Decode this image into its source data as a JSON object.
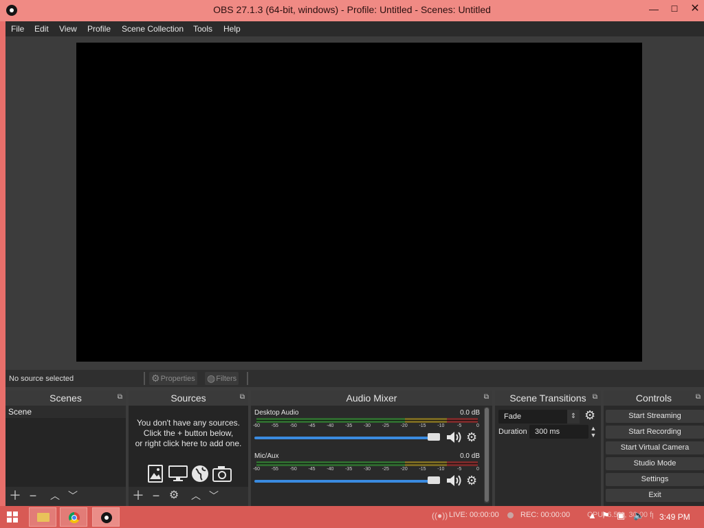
{
  "window": {
    "title": "OBS 27.1.3 (64-bit, windows) - Profile: Untitled - Scenes: Untitled",
    "controls": {
      "minimize": "—",
      "maximize": "☐",
      "close": "✕"
    }
  },
  "menu": [
    "File",
    "Edit",
    "View",
    "Profile",
    "Scene Collection",
    "Tools",
    "Help"
  ],
  "source_bar": {
    "no_source": "No source selected",
    "properties": "Properties",
    "filters": "Filters"
  },
  "scenes": {
    "title": "Scenes",
    "items": [
      "Scene"
    ]
  },
  "sources": {
    "title": "Sources",
    "empty_line1": "You don't have any sources.",
    "empty_line2": "Click the + button below,",
    "empty_line3": "or right click here to add one."
  },
  "audio_mixer": {
    "title": "Audio Mixer",
    "scale": [
      "-60",
      "-55",
      "-50",
      "-45",
      "-40",
      "-35",
      "-30",
      "-25",
      "-20",
      "-15",
      "-10",
      "-5",
      "0"
    ],
    "channels": [
      {
        "name": "Desktop Audio",
        "db": "0.0 dB",
        "volume_fraction": 1.0
      },
      {
        "name": "Mic/Aux",
        "db": "0.0 dB",
        "volume_fraction": 1.0
      }
    ]
  },
  "scene_transitions": {
    "title": "Scene Transitions",
    "transition": "Fade",
    "duration_label": "Duration",
    "duration_value": "300 ms"
  },
  "controls": {
    "title": "Controls",
    "buttons": [
      "Start Streaming",
      "Start Recording",
      "Start Virtual Camera",
      "Studio Mode",
      "Settings",
      "Exit"
    ]
  },
  "status": {
    "live": "LIVE: 00:00:00",
    "rec": "REC: 00:00:00",
    "cpu": "CPU: 6.5%, 30.00 fps",
    "time": "3:49 PM"
  },
  "colors": {
    "window_frame": "#e86f6b",
    "panel_bg": "#2a2a2a",
    "dock_title_bg": "#3a3a3a",
    "slider_accent": "#3a8be0"
  }
}
